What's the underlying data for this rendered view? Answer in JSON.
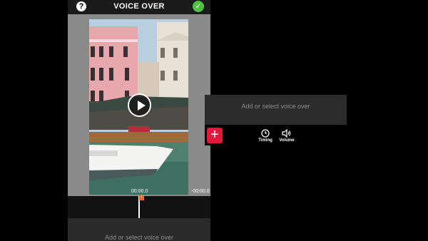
{
  "header": {
    "title": "VOICE OVER",
    "help_icon": "question-icon",
    "confirm_icon": "check-icon",
    "help_symbol": "?",
    "confirm_symbol": "✓"
  },
  "player": {
    "current_time": "00:00.0",
    "remaining_time": "-00:00.0",
    "play_icon": "play-icon"
  },
  "voice_over": {
    "empty_text": "Add or select voice over",
    "marker_label": "!"
  },
  "panel": {
    "empty_text": "Add or select voice over",
    "add_symbol": "+",
    "timing_label": "Timing",
    "volume_label": "Volume"
  },
  "colors": {
    "accent_red": "#e4183b",
    "confirm_green": "#4cc43e",
    "marker_orange": "#e86a1a"
  }
}
